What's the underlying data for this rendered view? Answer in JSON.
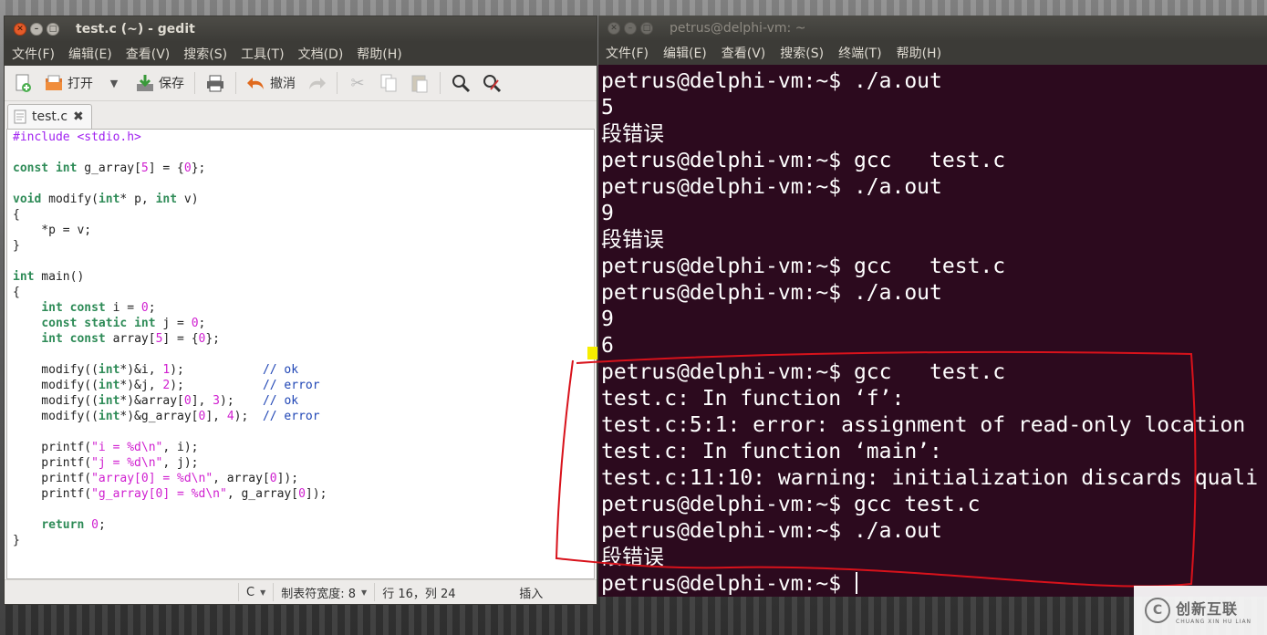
{
  "gedit": {
    "title": "test.c (~) - gedit",
    "menu": [
      "文件(F)",
      "编辑(E)",
      "查看(V)",
      "搜索(S)",
      "工具(T)",
      "文档(D)",
      "帮助(H)"
    ],
    "toolbar": {
      "open_label": "打开",
      "save_label": "保存",
      "undo_label": "撤消"
    },
    "tab": {
      "label": "test.c"
    },
    "code": [
      "#include <stdio.h>",
      "",
      "const int g_array[5] = {0};",
      "",
      "void modify(int* p, int v)",
      "{",
      "    *p = v;",
      "}",
      "",
      "int main()",
      "{",
      "    int const i = 0;",
      "    const static int j = 0;",
      "    int const array[5] = {0};",
      "",
      "    modify((int*)&i, 1);           // ok",
      "    modify((int*)&j, 2);           // error",
      "    modify((int*)&array[0], 3);    // ok",
      "    modify((int*)&g_array[0], 4);  // error",
      "",
      "    printf(\"i = %d\\n\", i);",
      "    printf(\"j = %d\\n\", j);",
      "    printf(\"array[0] = %d\\n\", array[0]);",
      "    printf(\"g_array[0] = %d\\n\", g_array[0]);",
      "",
      "    return 0;",
      "}"
    ],
    "status": {
      "language": "C",
      "tab_width": "制表符宽度: 8",
      "position": "行 16，列 24",
      "mode": "插入"
    }
  },
  "terminal": {
    "title": "petrus@delphi-vm: ~",
    "menu": [
      "文件(F)",
      "编辑(E)",
      "查看(V)",
      "搜索(S)",
      "终端(T)",
      "帮助(H)"
    ],
    "lines": [
      "petrus@delphi-vm:~$ ./a.out",
      "5",
      "段错误",
      "petrus@delphi-vm:~$ gcc   test.c",
      "petrus@delphi-vm:~$ ./a.out",
      "9",
      "段错误",
      "petrus@delphi-vm:~$ gcc   test.c",
      "petrus@delphi-vm:~$ ./a.out",
      "9",
      "6",
      "petrus@delphi-vm:~$ gcc   test.c",
      "test.c: In function ‘f’:",
      "test.c:5:1: error: assignment of read-only location",
      "test.c: In function ‘main’:",
      "test.c:11:10: warning: initialization discards quali",
      "petrus@delphi-vm:~$ gcc test.c",
      "petrus@delphi-vm:~$ ./a.out",
      "段错误",
      "petrus@delphi-vm:~$ "
    ]
  },
  "watermark": {
    "name": "创新互联",
    "subtitle": "CHUANG XIN HU LIAN"
  },
  "colors": {
    "terminal_bg": "#2c0a1e",
    "annotation": "#d8121b",
    "highlight": "#f7ee00"
  }
}
